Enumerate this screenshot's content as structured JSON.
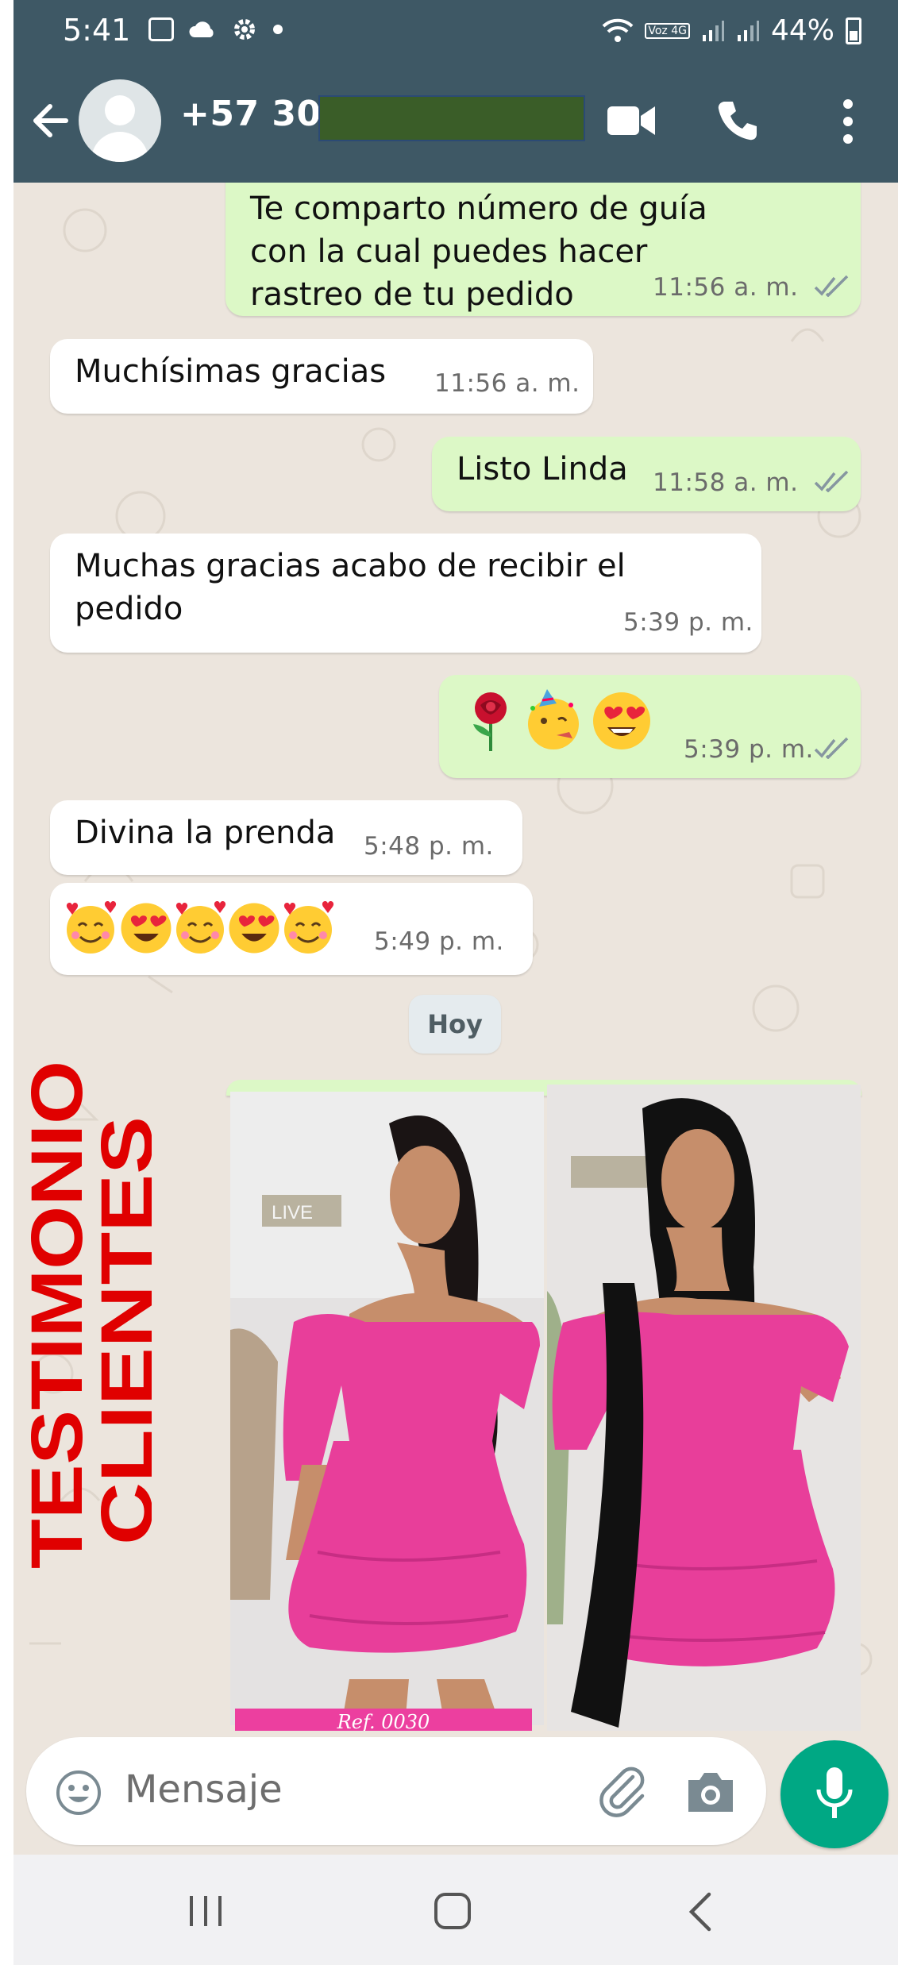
{
  "status_bar": {
    "time": "5:41",
    "battery": "44%",
    "network_badge": "Voz 4G"
  },
  "header": {
    "contact_visible": "+57 304"
  },
  "messages": [
    {
      "dir": "out",
      "text": "Te comparto número de guía con la cual puedes hacer rastreo de tu pedido",
      "time": "11:56 a. m.",
      "read": true
    },
    {
      "dir": "in",
      "text": "Muchísimas gracias",
      "time": "11:56 a. m."
    },
    {
      "dir": "out",
      "text": "Listo Linda",
      "time": "11:58 a. m.",
      "read": true
    },
    {
      "dir": "in",
      "text": "Muchas gracias acabo de recibir el pedido",
      "time": "5:39 p. m."
    },
    {
      "dir": "out",
      "emojis": [
        "rose",
        "partying-face",
        "heart-eyes"
      ],
      "time": "5:39 p. m.",
      "read": true
    },
    {
      "dir": "in",
      "text": "Divina la prenda",
      "time": "5:48 p. m."
    },
    {
      "dir": "in",
      "emojis": [
        "smiling-hearts",
        "heart-eyes",
        "smiling-hearts",
        "heart-eyes",
        "smiling-hearts"
      ],
      "time": "5:49 p. m."
    }
  ],
  "day_separator": "Hoy",
  "photos": {
    "ref_label": "Ref. 0030",
    "sign_text": "LIVE",
    "dress_color": "#e83e9a"
  },
  "overlay": {
    "line1": "TESTIMONIO",
    "line2": "CLIENTES",
    "color": "#e00000"
  },
  "input": {
    "placeholder": "Mensaje"
  },
  "colors": {
    "header": "#3e5865",
    "outgoing_bubble": "#dcf8c6",
    "incoming_bubble": "#ffffff",
    "chat_bg": "#ece5dd",
    "mic_button": "#00a884",
    "read_tick": "#8696a0"
  }
}
